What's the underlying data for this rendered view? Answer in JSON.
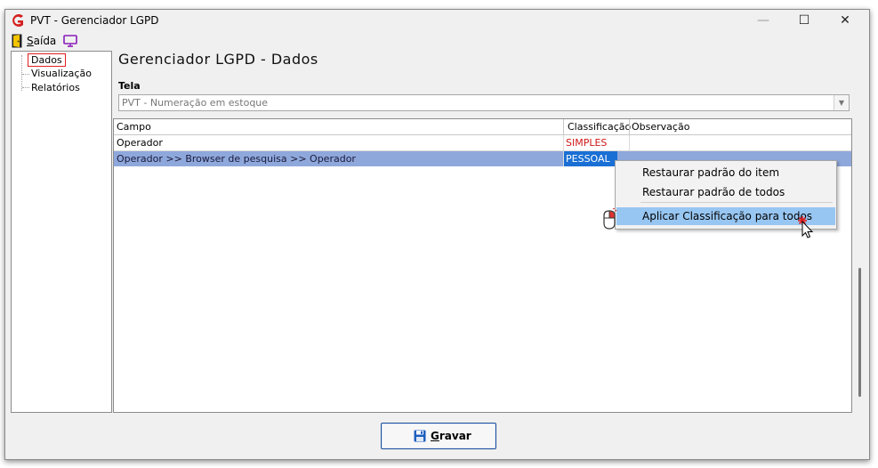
{
  "window": {
    "title": "PVT - Gerenciador LGPD",
    "minimize_glyph": "—",
    "maximize_glyph": "☐",
    "close_glyph": "✕"
  },
  "menu": {
    "exit_label_accel": "S",
    "exit_label_rest": "aída"
  },
  "tree": {
    "items": [
      {
        "label": "Dados",
        "selected": true
      },
      {
        "label": "Visualização",
        "selected": false
      },
      {
        "label": "Relatórios",
        "selected": false
      }
    ]
  },
  "main": {
    "title": "Gerenciador LGPD - Dados",
    "tela_label": "Tela",
    "tela_value": "PVT - Numeração em estoque"
  },
  "grid": {
    "columns": [
      "Campo",
      "Classificação",
      "Observação"
    ],
    "rows": [
      {
        "campo": "Operador",
        "classificacao": "SIMPLES",
        "observacao": ""
      },
      {
        "campo": "Operador >> Browser de pesquisa >> Operador",
        "classificacao": "PESSOAL",
        "observacao": "",
        "selected": true
      }
    ]
  },
  "context_menu": {
    "items": [
      "Restaurar padrão do item",
      "Restaurar padrão de todos",
      "Aplicar Classificação para todos"
    ],
    "highlighted_index": 2
  },
  "footer": {
    "save_accel": "G",
    "save_rest": "ravar"
  },
  "colors": {
    "selection_row": "#8fa8dc",
    "classification_simples": "#d01818",
    "classification_pessoal_bg": "#1a6fd4",
    "menu_highlight": "#98c6f2"
  }
}
